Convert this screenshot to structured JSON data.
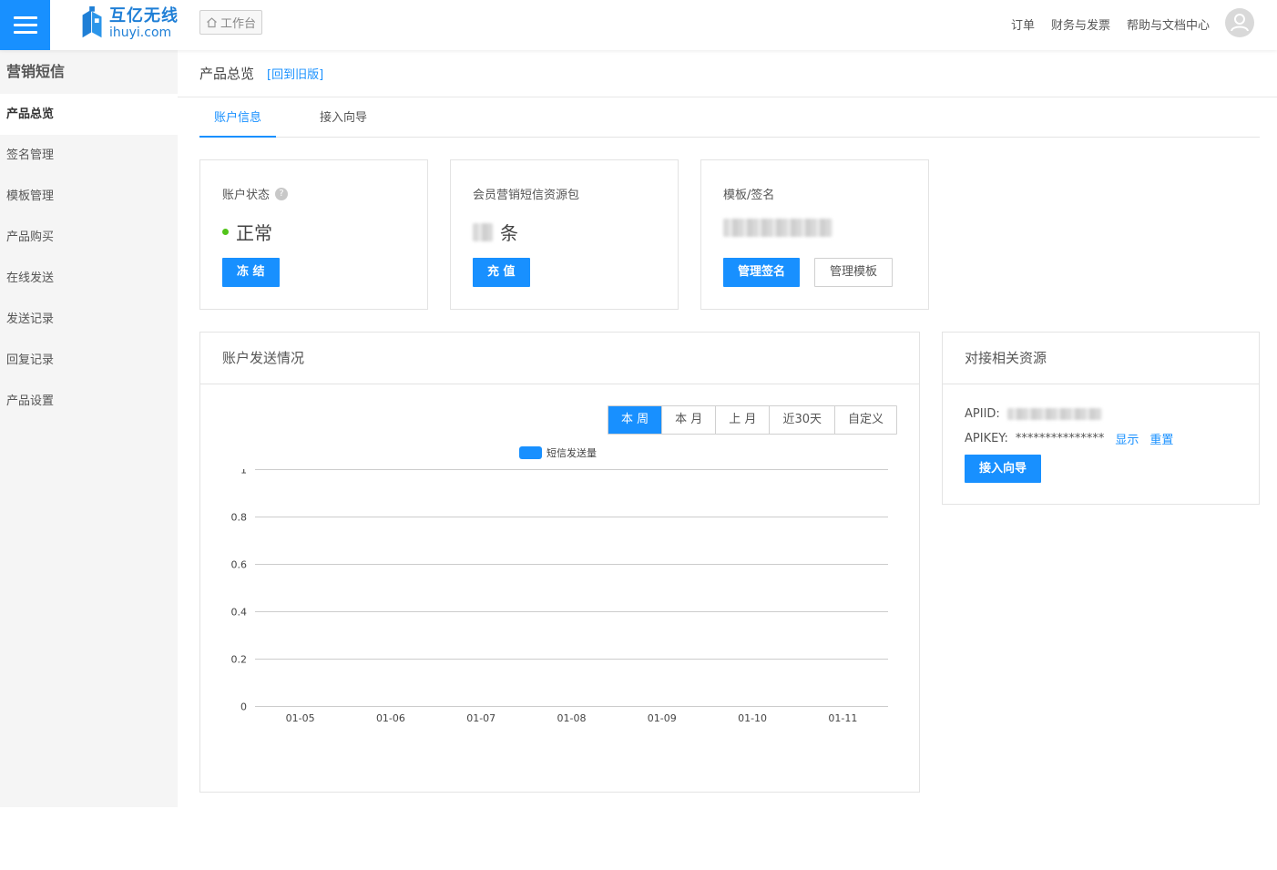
{
  "header": {
    "logo_cn": "互亿无线",
    "logo_en": "ihuyi.com",
    "workbench_label": "工作台",
    "links": [
      "订单",
      "财务与发票",
      "帮助与文档中心"
    ]
  },
  "sidebar": {
    "title": "营销短信",
    "items": [
      {
        "label": "产品总览",
        "active": true
      },
      {
        "label": "签名管理",
        "active": false
      },
      {
        "label": "模板管理",
        "active": false
      },
      {
        "label": "产品购买",
        "active": false
      },
      {
        "label": "在线发送",
        "active": false
      },
      {
        "label": "发送记录",
        "active": false
      },
      {
        "label": "回复记录",
        "active": false
      },
      {
        "label": "产品设置",
        "active": false
      }
    ]
  },
  "breadcrumb": {
    "title": "产品总览",
    "back_link": "[回到旧版]"
  },
  "tabs": [
    {
      "label": "账户信息",
      "active": true
    },
    {
      "label": "接入向导",
      "active": false
    }
  ],
  "cards": {
    "status": {
      "label": "账户状态",
      "value": "正常",
      "button": "冻 结"
    },
    "package": {
      "label": "会员营销短信资源包",
      "unit": "条",
      "button": "充 值"
    },
    "template": {
      "label": "模板/签名",
      "button_sign": "管理签名",
      "button_template": "管理模板"
    }
  },
  "send_panel": {
    "title": "账户发送情况",
    "ranges": [
      {
        "label": "本 周",
        "active": true
      },
      {
        "label": "本 月",
        "active": false
      },
      {
        "label": "上 月",
        "active": false
      },
      {
        "label": "近30天",
        "active": false
      },
      {
        "label": "自定义",
        "active": false
      }
    ]
  },
  "resources": {
    "title": "对接相关资源",
    "apiid_label": "APIID:",
    "apikey_label": "APIKEY:",
    "apikey_value": "***************",
    "show_link": "显示",
    "reset_link": "重置",
    "guide_button": "接入向导"
  },
  "colors": {
    "accent": "#1890ff",
    "status_ok": "#52c41a"
  },
  "chart_data": {
    "type": "bar",
    "categories": [
      "01-05",
      "01-06",
      "01-07",
      "01-08",
      "01-09",
      "01-10",
      "01-11"
    ],
    "series": [
      {
        "name": "短信发送量",
        "values": [
          0,
          0,
          0,
          0,
          0,
          0,
          0
        ]
      }
    ],
    "yticks": [
      "0",
      "0.2",
      "0.4",
      "0.6",
      "0.8",
      "1"
    ],
    "ylim": [
      0,
      1
    ],
    "grid": true,
    "legend": "top-center",
    "title": "",
    "xlabel": "",
    "ylabel": ""
  }
}
